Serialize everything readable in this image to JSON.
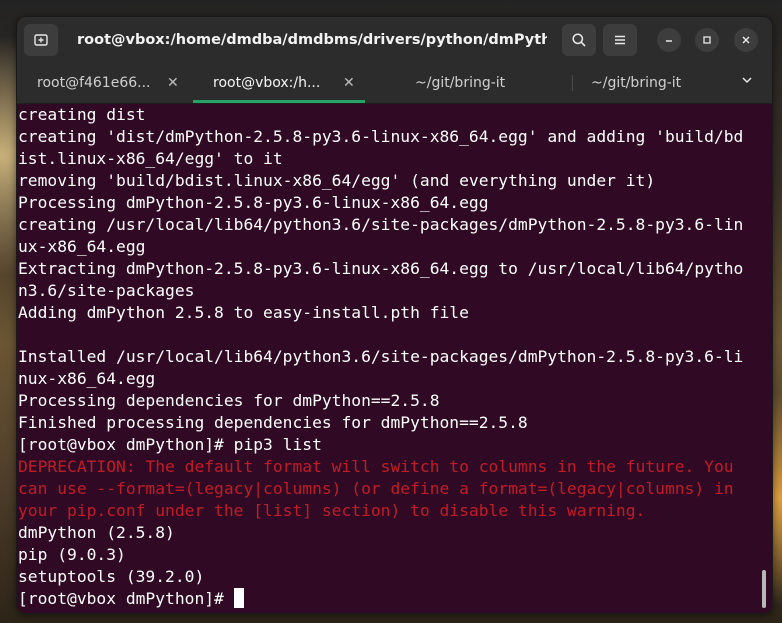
{
  "window": {
    "title": "root@vbox:/home/dmdba/dmdbms/drivers/python/dmPython"
  },
  "titlebar": {
    "new_tab_icon": "new-tab-icon",
    "search_icon": "search-icon",
    "menu_icon": "hamburger-menu-icon",
    "minimize_icon": "minimize-icon",
    "maximize_icon": "maximize-icon",
    "close_icon": "close-icon"
  },
  "tabs": [
    {
      "label": "root@f461e66...",
      "active": false
    },
    {
      "label": "root@vbox:/h...",
      "active": true
    },
    {
      "label": "~/git/bring-it",
      "active": false
    },
    {
      "label": "~/git/bring-it",
      "active": false
    }
  ],
  "tab_close_glyph": "✕",
  "terminal": {
    "lines": [
      {
        "text": "creating dist",
        "style": "normal"
      },
      {
        "text": "creating 'dist/dmPython-2.5.8-py3.6-linux-x86_64.egg' and adding 'build/bd",
        "style": "normal"
      },
      {
        "text": "ist.linux-x86_64/egg' to it",
        "style": "normal"
      },
      {
        "text": "removing 'build/bdist.linux-x86_64/egg' (and everything under it)",
        "style": "normal"
      },
      {
        "text": "Processing dmPython-2.5.8-py3.6-linux-x86_64.egg",
        "style": "normal"
      },
      {
        "text": "creating /usr/local/lib64/python3.6/site-packages/dmPython-2.5.8-py3.6-lin",
        "style": "normal"
      },
      {
        "text": "ux-x86_64.egg",
        "style": "normal"
      },
      {
        "text": "Extracting dmPython-2.5.8-py3.6-linux-x86_64.egg to /usr/local/lib64/pytho",
        "style": "normal"
      },
      {
        "text": "n3.6/site-packages",
        "style": "normal"
      },
      {
        "text": "Adding dmPython 2.5.8 to easy-install.pth file",
        "style": "normal"
      },
      {
        "text": "",
        "style": "normal"
      },
      {
        "text": "Installed /usr/local/lib64/python3.6/site-packages/dmPython-2.5.8-py3.6-li",
        "style": "normal"
      },
      {
        "text": "nux-x86_64.egg",
        "style": "normal"
      },
      {
        "text": "Processing dependencies for dmPython==2.5.8",
        "style": "normal"
      },
      {
        "text": "Finished processing dependencies for dmPython==2.5.8",
        "style": "normal"
      },
      {
        "text": "[root@vbox dmPython]# pip3 list",
        "style": "normal"
      },
      {
        "text": "DEPRECATION: The default format will switch to columns in the future. You",
        "style": "warn"
      },
      {
        "text": "can use --format=(legacy|columns) (or define a format=(legacy|columns) in",
        "style": "warn"
      },
      {
        "text": "your pip.conf under the [list] section) to disable this warning.",
        "style": "warn"
      },
      {
        "text": "dmPython (2.5.8)",
        "style": "normal"
      },
      {
        "text": "pip (9.0.3)",
        "style": "normal"
      },
      {
        "text": "setuptools (39.2.0)",
        "style": "normal"
      }
    ],
    "prompt": "[root@vbox dmPython]# ",
    "text_color": "#ffffff",
    "warning_color": "#c01c28",
    "background_color": "#300a24"
  },
  "colors": {
    "accent_tab_underline": "#26a269",
    "chrome": "#2c2c2c"
  }
}
